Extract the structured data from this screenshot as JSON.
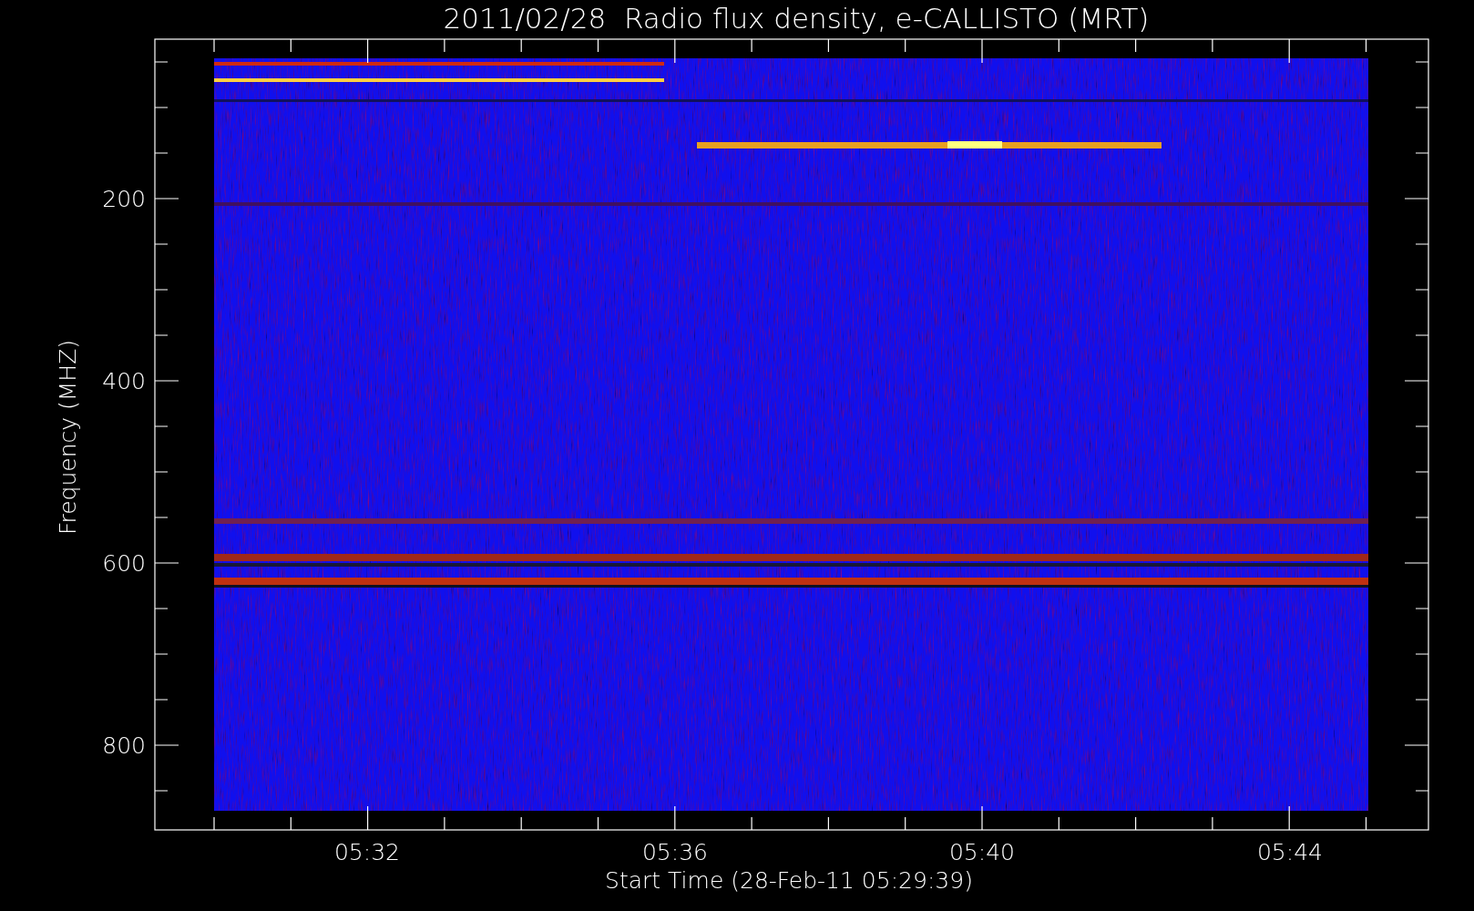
{
  "title": "2011/02/28  Radio flux density, e-CALLISTO (MRT)",
  "y_axis": {
    "label": "Frequency (MHZ)",
    "ticks": [
      "200",
      "400",
      "600",
      "800"
    ]
  },
  "x_axis": {
    "label": "Start Time (28-Feb-11 05:29:39)",
    "ticks": [
      "05:32",
      "05:36",
      "05:40",
      "05:44"
    ]
  }
}
